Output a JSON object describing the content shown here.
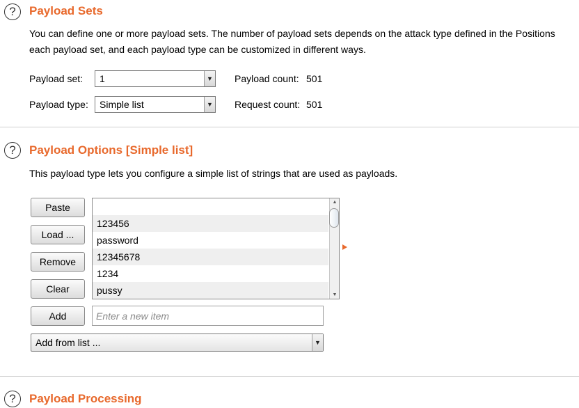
{
  "payload_sets": {
    "title": "Payload Sets",
    "desc_line1": "You can define one or more payload sets. The number of payload sets depends on the attack type defined in the Positions",
    "desc_line2": "each payload set, and each payload type can be customized in different ways.",
    "payload_set_label": "Payload set:",
    "payload_set_value": "1",
    "payload_type_label": "Payload type:",
    "payload_type_value": "Simple list",
    "payload_count_label": "Payload count:",
    "payload_count_value": "501",
    "request_count_label": "Request count:",
    "request_count_value": "501"
  },
  "payload_options": {
    "title": "Payload Options [Simple list]",
    "desc": "This payload type lets you configure a simple list of strings that are used as payloads.",
    "buttons": {
      "paste": "Paste",
      "load": "Load ...",
      "remove": "Remove",
      "clear": "Clear",
      "add": "Add"
    },
    "list_items": [
      "",
      "123456",
      "password",
      "12345678",
      "1234",
      "pussy"
    ],
    "new_item_placeholder": "Enter a new item",
    "add_from_list_value": "Add from list ..."
  },
  "payload_processing": {
    "title": "Payload Processing"
  },
  "icons": {
    "help": "?",
    "dropdown": "▼",
    "scroll_up": "▲",
    "scroll_down": "▼"
  },
  "colors": {
    "accent": "#e8692c"
  }
}
